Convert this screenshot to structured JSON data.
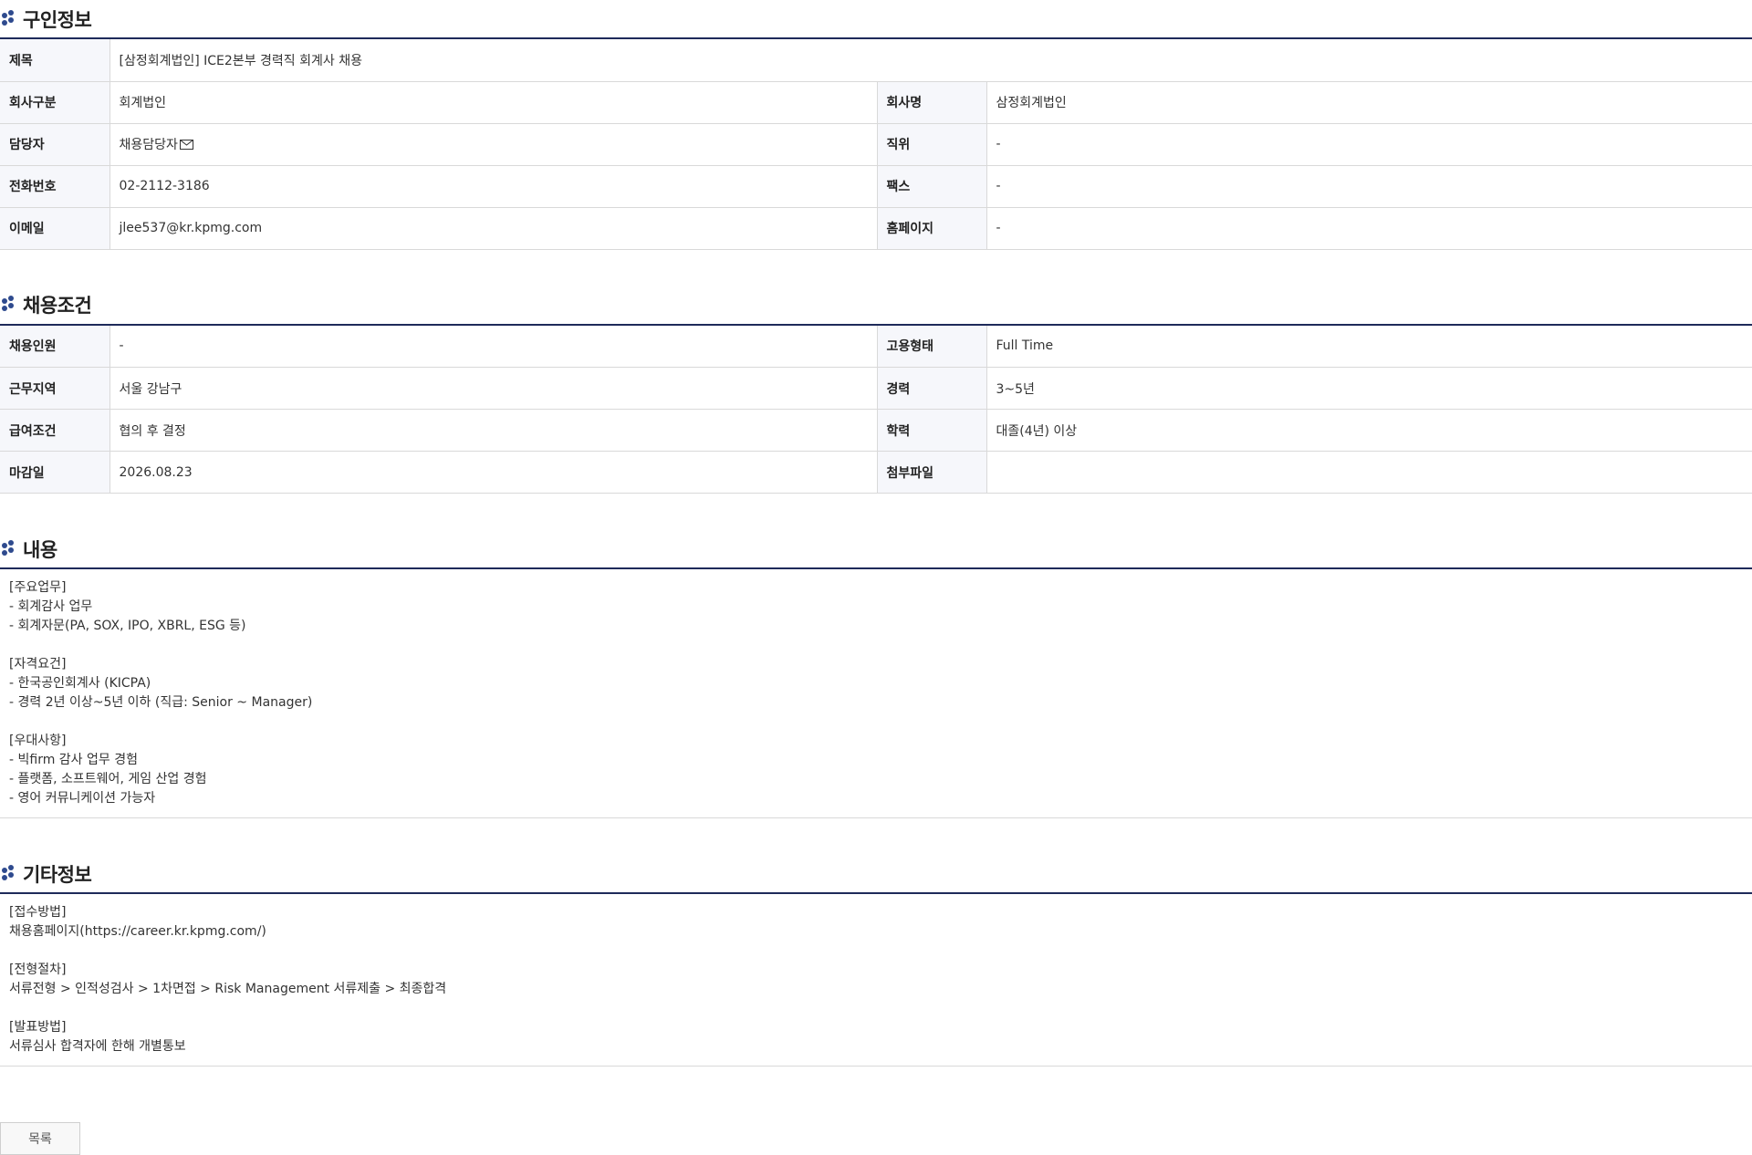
{
  "sections": {
    "recruit_info": {
      "title": "구인정보"
    },
    "conditions": {
      "title": "채용조건"
    },
    "content": {
      "title": "내용"
    },
    "other": {
      "title": "기타정보"
    }
  },
  "recruit": {
    "title_label": "제목",
    "title_value": "[삼정회계법인] ICE2본부 경력직 회계사 채용",
    "company_type_label": "회사구분",
    "company_type_value": "회계법인",
    "company_name_label": "회사명",
    "company_name_value": "삼정회계법인",
    "contact_label": "담당자",
    "contact_value": "채용담당자",
    "position_label": "직위",
    "position_value": "-",
    "phone_label": "전화번호",
    "phone_value": "02-2112-3186",
    "fax_label": "팩스",
    "fax_value": "-",
    "email_label": "이메일",
    "email_value": "jlee537@kr.kpmg.com",
    "homepage_label": "홈페이지",
    "homepage_value": "-"
  },
  "conditions": {
    "headcount_label": "채용인원",
    "headcount_value": "-",
    "employment_type_label": "고용형태",
    "employment_type_value": "Full Time",
    "location_label": "근무지역",
    "location_value": "서울 강남구",
    "experience_label": "경력",
    "experience_value": "3~5년",
    "salary_label": "급여조건",
    "salary_value": "협의 후 결정",
    "education_label": "학력",
    "education_value": "대졸(4년) 이상",
    "deadline_label": "마감일",
    "deadline_value": "2026.08.23",
    "attachment_label": "첨부파일",
    "attachment_value": ""
  },
  "content": {
    "lines": [
      "[주요업무]",
      "- 회계감사 업무",
      "- 회계자문(PA, SOX, IPO, XBRL, ESG 등)",
      "",
      "[자격요건]",
      "- 한국공인회계사 (KICPA)",
      "- 경력 2년 이상~5년 이하 (직급: Senior ~ Manager)",
      "",
      "[우대사항]",
      "- 빅firm 감사 업무 경험",
      "- 플랫폼, 소프트웨어, 게임 산업 경험",
      "- 영어 커뮤니케이션 가능자"
    ]
  },
  "other": {
    "lines": [
      "[접수방법]",
      "채용홈페이지(https://career.kr.kpmg.com/)",
      "",
      "[전형절차]",
      "서류전형 > 인적성검사 > 1차면접 > Risk Management 서류제출 > 최종합격",
      "",
      "[발표방법]",
      "서류심사 합격자에 한해 개별통보"
    ]
  },
  "buttons": {
    "list_label": "목록"
  },
  "icons": {
    "section_icon": "dots-icon",
    "mail_icon": "envelope-icon"
  },
  "colors": {
    "accent": "#1e2a5a",
    "header_bg": "#f6f7fb",
    "icon": "#2e4a8e"
  }
}
